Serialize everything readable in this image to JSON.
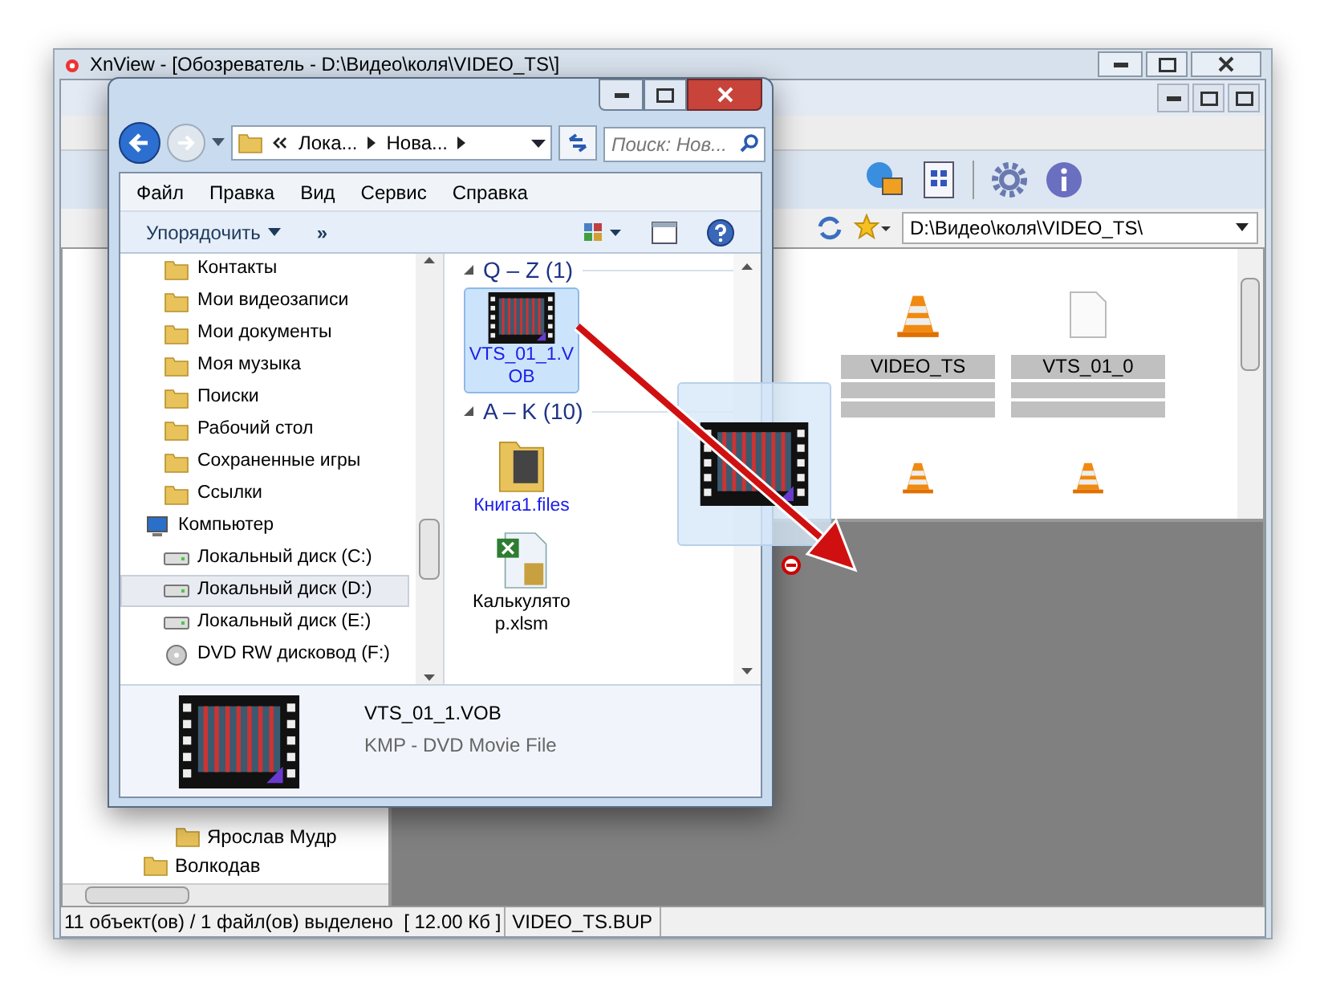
{
  "xnview": {
    "title": "XnView - [Обозреватель - D:\\Видео\\коля\\VIDEO_TS\\]",
    "address": "D:\\Видео\\коля\\VIDEO_TS\\",
    "tree": [
      {
        "children": [
          {
            "label": "Ярослав Мудр"
          }
        ]
      },
      {
        "label": "Волкодав"
      }
    ],
    "thumbnails": [
      {
        "name": "VIDEO_TS",
        "kind": "cone"
      },
      {
        "name": "VTS_01_0",
        "kind": "file"
      },
      {
        "kind": "cone"
      },
      {
        "kind": "cone"
      }
    ],
    "status_bar": [
      "11 объект(ов) / 1 файл(ов) выделено  [ 12.00 Кб ]",
      "VIDEO_TS.BUP"
    ]
  },
  "explorer": {
    "breadcrumb": [
      "Лока...",
      "Нова..."
    ],
    "search": {
      "placeholder": "Поиск: Нов..."
    },
    "menu": [
      "Файл",
      "Правка",
      "Вид",
      "Сервис",
      "Справка"
    ],
    "organize": "Упорядочить",
    "more": "»",
    "nav": [
      {
        "children": [
          {
            "label": "Контакты",
            "kind": "folder",
            "selected": false
          },
          {
            "label": "Мои видеозаписи",
            "kind": "folder",
            "selected": false
          },
          {
            "label": "Мои документы",
            "kind": "folder",
            "selected": false
          },
          {
            "label": "Моя музыка",
            "kind": "folder",
            "selected": false
          },
          {
            "label": "Поиски",
            "kind": "folder",
            "selected": false
          },
          {
            "label": "Рабочий стол",
            "kind": "folder",
            "selected": false
          },
          {
            "label": "Сохраненные игры",
            "kind": "folder",
            "selected": false
          },
          {
            "label": "Ссылки",
            "kind": "folder",
            "selected": false
          }
        ]
      },
      {
        "label": "Компьютер",
        "kind": "computer",
        "selected": false,
        "children": [
          {
            "label": "Локальный диск (C:)",
            "kind": "drive",
            "selected": false
          },
          {
            "label": "Локальный диск (D:)",
            "kind": "drive",
            "selected": true
          },
          {
            "label": "Локальный диск (E:)",
            "kind": "drive",
            "selected": false
          },
          {
            "label": "DVD RW дисковод (F:)",
            "kind": "dvd",
            "selected": false
          }
        ]
      }
    ],
    "groups": [
      {
        "header": "Q – Z (1)",
        "items": [
          {
            "name": "VTS_01_1.VOB",
            "kind": "video",
            "selected": true,
            "compressed": true
          }
        ]
      },
      {
        "header": "A – K (10)",
        "items": [
          {
            "name": "Книга1.files",
            "kind": "folder",
            "selected": false,
            "compressed": true
          },
          {
            "name": "Калькулятор.xlsm",
            "kind": "excel",
            "selected": false,
            "compressed": false
          }
        ]
      }
    ],
    "details": {
      "name": "VTS_01_1.VOB",
      "type": "KMP - DVD Movie File"
    }
  }
}
